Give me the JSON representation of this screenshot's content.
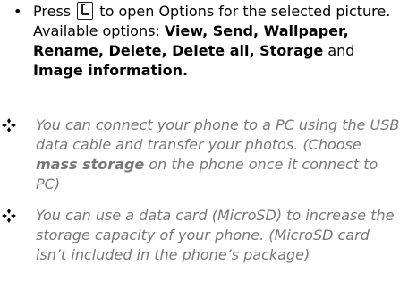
{
  "bullet": {
    "press_word": "Press",
    "key_icon": "left-softkey-icon",
    "text_before_options": "to open Options for the selected picture. Available options:",
    "options_bold": "View, Send, Wallpaper, Rename, Delete, Delete all, Storage",
    "and_word": "and",
    "last_option_bold": "Image information."
  },
  "notes": [
    {
      "icon": "four-diamond-bullet-icon",
      "text_before": "You can connect your phone to a PC using the USB data cable and transfer your photos. (Choose",
      "bold": "mass storage",
      "text_after": "on the phone once it connect to PC)"
    },
    {
      "icon": "four-diamond-bullet-icon",
      "text": "You can use a data card (MicroSD) to increase the storage capacity of your phone. (MicroSD card isn’t included in the phone’s package)"
    }
  ],
  "colors": {
    "body_text": "#000000",
    "note_text": "#777777"
  }
}
